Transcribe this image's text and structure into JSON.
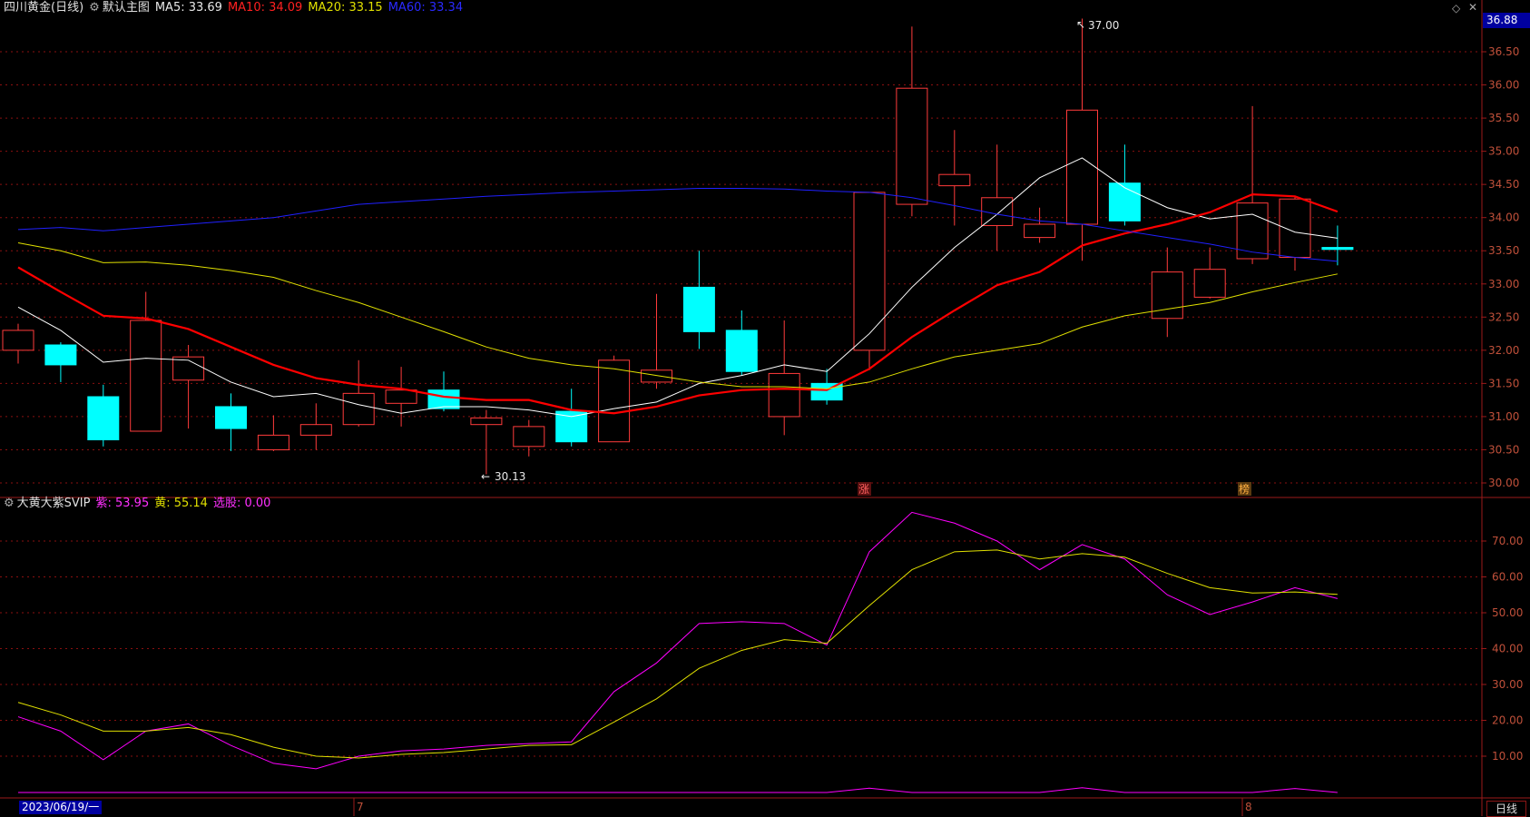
{
  "main_panel": {
    "stock_name": "四川黄金(日线)",
    "template_label": "默认主图",
    "ma5_label": "MA5: 33.69",
    "ma10_label": "MA10: 34.09",
    "ma20_label": "MA20: 33.15",
    "ma60_label": "MA60: 33.34",
    "current_price": "36.88",
    "high_annotation": "37.00",
    "low_annotation": "30.13",
    "marker_zhang": "涨",
    "marker_bang": "榜"
  },
  "sub_panel": {
    "indicator_name": "大黄大紫SVIP",
    "purple_label": "紫: 53.95",
    "yellow_label": "黄: 55.14",
    "pick_label": "选股: 0.00"
  },
  "bottom_bar": {
    "date_label": "2023/06/19/一",
    "month7": "7",
    "month8": "8",
    "period_button": "日线"
  },
  "colors": {
    "up": "#ff3b3b",
    "down": "#00ffff",
    "ma5": "#ffffff",
    "ma10": "#ff0000",
    "ma20": "#e0e000",
    "ma60": "#2020ff",
    "purple": "#ff00ff",
    "yellow": "#e0e000",
    "grid": "#8a1010"
  },
  "chart_data": [
    {
      "type": "candlestick",
      "title": "四川黄金(日线)",
      "ylim": [
        29.8,
        36.9
      ],
      "y_ticks": [
        30.0,
        30.5,
        31.0,
        31.5,
        32.0,
        32.5,
        33.0,
        33.5,
        34.0,
        34.5,
        35.0,
        35.5,
        36.0,
        36.5
      ],
      "y_tick_labels": [
        "30.00",
        "30.50",
        "31.00",
        "31.50",
        "32.00",
        "32.50",
        "33.00",
        "33.50",
        "34.00",
        "34.50",
        "35.00",
        "35.50",
        "36.00",
        "36.50"
      ],
      "candles": [
        {
          "o": 32.0,
          "c": 32.3,
          "h": 32.4,
          "l": 31.8
        },
        {
          "o": 32.08,
          "c": 31.78,
          "h": 32.12,
          "l": 31.52
        },
        {
          "o": 31.3,
          "c": 30.65,
          "h": 31.48,
          "l": 30.55
        },
        {
          "o": 30.78,
          "c": 32.45,
          "h": 32.88,
          "l": 30.78
        },
        {
          "o": 31.55,
          "c": 31.9,
          "h": 32.08,
          "l": 30.82
        },
        {
          "o": 31.15,
          "c": 30.82,
          "h": 31.35,
          "l": 30.48
        },
        {
          "o": 30.5,
          "c": 30.72,
          "h": 31.02,
          "l": 30.48
        },
        {
          "o": 30.72,
          "c": 30.88,
          "h": 31.2,
          "l": 30.5
        },
        {
          "o": 30.88,
          "c": 31.35,
          "h": 31.85,
          "l": 30.85
        },
        {
          "o": 31.2,
          "c": 31.4,
          "h": 31.75,
          "l": 30.85
        },
        {
          "o": 31.4,
          "c": 31.12,
          "h": 31.68,
          "l": 31.08
        },
        {
          "o": 30.88,
          "c": 30.98,
          "h": 31.1,
          "l": 30.13
        },
        {
          "o": 30.55,
          "c": 30.85,
          "h": 30.95,
          "l": 30.4
        },
        {
          "o": 31.08,
          "c": 30.62,
          "h": 31.42,
          "l": 30.55
        },
        {
          "o": 30.62,
          "c": 31.85,
          "h": 31.92,
          "l": 30.62
        },
        {
          "o": 31.52,
          "c": 31.7,
          "h": 32.85,
          "l": 31.42
        },
        {
          "o": 32.95,
          "c": 32.28,
          "h": 33.5,
          "l": 32.02
        },
        {
          "o": 32.3,
          "c": 31.68,
          "h": 32.6,
          "l": 31.62
        },
        {
          "o": 31.0,
          "c": 31.65,
          "h": 32.45,
          "l": 30.72
        },
        {
          "o": 31.5,
          "c": 31.25,
          "h": 31.72,
          "l": 31.18
        },
        {
          "o": 32.0,
          "c": 34.38,
          "h": 34.38,
          "l": 31.7
        },
        {
          "o": 34.2,
          "c": 35.95,
          "h": 36.88,
          "l": 34.02
        },
        {
          "o": 34.48,
          "c": 34.65,
          "h": 35.32,
          "l": 33.88
        },
        {
          "o": 33.88,
          "c": 34.3,
          "h": 35.1,
          "l": 33.5
        },
        {
          "o": 33.7,
          "c": 33.9,
          "h": 34.15,
          "l": 33.62
        },
        {
          "o": 33.9,
          "c": 35.62,
          "h": 37.0,
          "l": 33.35
        },
        {
          "o": 34.52,
          "c": 33.95,
          "h": 35.1,
          "l": 33.88
        },
        {
          "o": 32.48,
          "c": 33.18,
          "h": 33.55,
          "l": 32.2
        },
        {
          "o": 32.8,
          "c": 33.22,
          "h": 33.55,
          "l": 32.78
        },
        {
          "o": 33.38,
          "c": 34.22,
          "h": 35.68,
          "l": 33.3
        },
        {
          "o": 33.4,
          "c": 34.28,
          "h": 34.32,
          "l": 33.2
        },
        {
          "o": 33.55,
          "c": 33.52,
          "h": 33.88,
          "l": 33.28
        }
      ],
      "series": [
        {
          "name": "MA5",
          "values": [
            32.65,
            32.3,
            31.82,
            31.88,
            31.85,
            31.52,
            31.3,
            31.35,
            31.18,
            31.05,
            31.15,
            31.15,
            31.1,
            31.0,
            31.12,
            31.22,
            31.5,
            31.62,
            31.78,
            31.68,
            32.25,
            32.95,
            33.55,
            34.05,
            34.6,
            34.9,
            34.45,
            34.15,
            33.98,
            34.05,
            33.78,
            33.69
          ]
        },
        {
          "name": "MA10",
          "values": [
            33.25,
            32.88,
            32.52,
            32.48,
            32.32,
            32.05,
            31.78,
            31.58,
            31.48,
            31.42,
            31.3,
            31.25,
            31.25,
            31.1,
            31.05,
            31.15,
            31.32,
            31.4,
            31.42,
            31.4,
            31.72,
            32.2,
            32.6,
            32.98,
            33.18,
            33.58,
            33.76,
            33.9,
            34.08,
            34.35,
            34.32,
            34.09
          ]
        },
        {
          "name": "MA20",
          "values": [
            33.62,
            33.5,
            33.32,
            33.33,
            33.28,
            33.2,
            33.1,
            32.9,
            32.72,
            32.5,
            32.28,
            32.05,
            31.88,
            31.78,
            31.72,
            31.62,
            31.52,
            31.45,
            31.45,
            31.42,
            31.52,
            31.72,
            31.9,
            32.0,
            32.1,
            32.35,
            32.52,
            32.62,
            32.72,
            32.88,
            33.02,
            33.15
          ]
        },
        {
          "name": "MA60",
          "values": [
            33.82,
            33.85,
            33.8,
            33.85,
            33.9,
            33.95,
            34.0,
            34.1,
            34.2,
            34.24,
            34.28,
            34.32,
            34.35,
            34.38,
            34.4,
            34.42,
            34.44,
            34.44,
            34.43,
            34.4,
            34.38,
            34.3,
            34.18,
            34.05,
            33.95,
            33.9,
            33.8,
            33.7,
            33.6,
            33.48,
            33.4,
            33.34
          ]
        }
      ]
    },
    {
      "type": "line",
      "title": "大黄大紫SVIP",
      "ylim": [
        0,
        82
      ],
      "y_ticks": [
        10,
        20,
        30,
        40,
        50,
        60,
        70
      ],
      "y_tick_labels": [
        "10.00",
        "20.00",
        "30.00",
        "40.00",
        "50.00",
        "60.00",
        "70.00"
      ],
      "series": [
        {
          "name": "紫",
          "values": [
            21,
            17,
            9,
            17,
            19,
            13,
            8,
            6.5,
            10,
            11.5,
            12,
            13,
            13.5,
            14,
            28,
            36,
            47,
            47.5,
            47,
            41,
            67,
            78,
            75,
            70,
            62,
            69,
            65,
            55,
            49.5,
            53,
            57,
            53.95
          ]
        },
        {
          "name": "黄",
          "values": [
            25,
            21.5,
            17,
            17,
            18,
            16,
            12.5,
            10,
            9.5,
            10.5,
            11,
            12,
            13,
            13.2,
            19.5,
            26,
            34.5,
            39.5,
            42.5,
            41.5,
            52,
            62,
            67,
            67.5,
            65,
            66.5,
            65.5,
            61,
            57,
            55.5,
            55.8,
            55.14
          ]
        },
        {
          "name": "选股",
          "values": [
            0,
            0,
            0,
            0,
            0,
            0,
            0,
            0,
            0,
            0,
            0,
            0,
            0,
            0,
            0,
            0,
            0,
            0,
            0,
            0,
            1.2,
            0,
            0,
            0,
            0,
            1.3,
            0,
            0,
            0,
            0,
            1.1,
            0
          ]
        }
      ]
    }
  ]
}
